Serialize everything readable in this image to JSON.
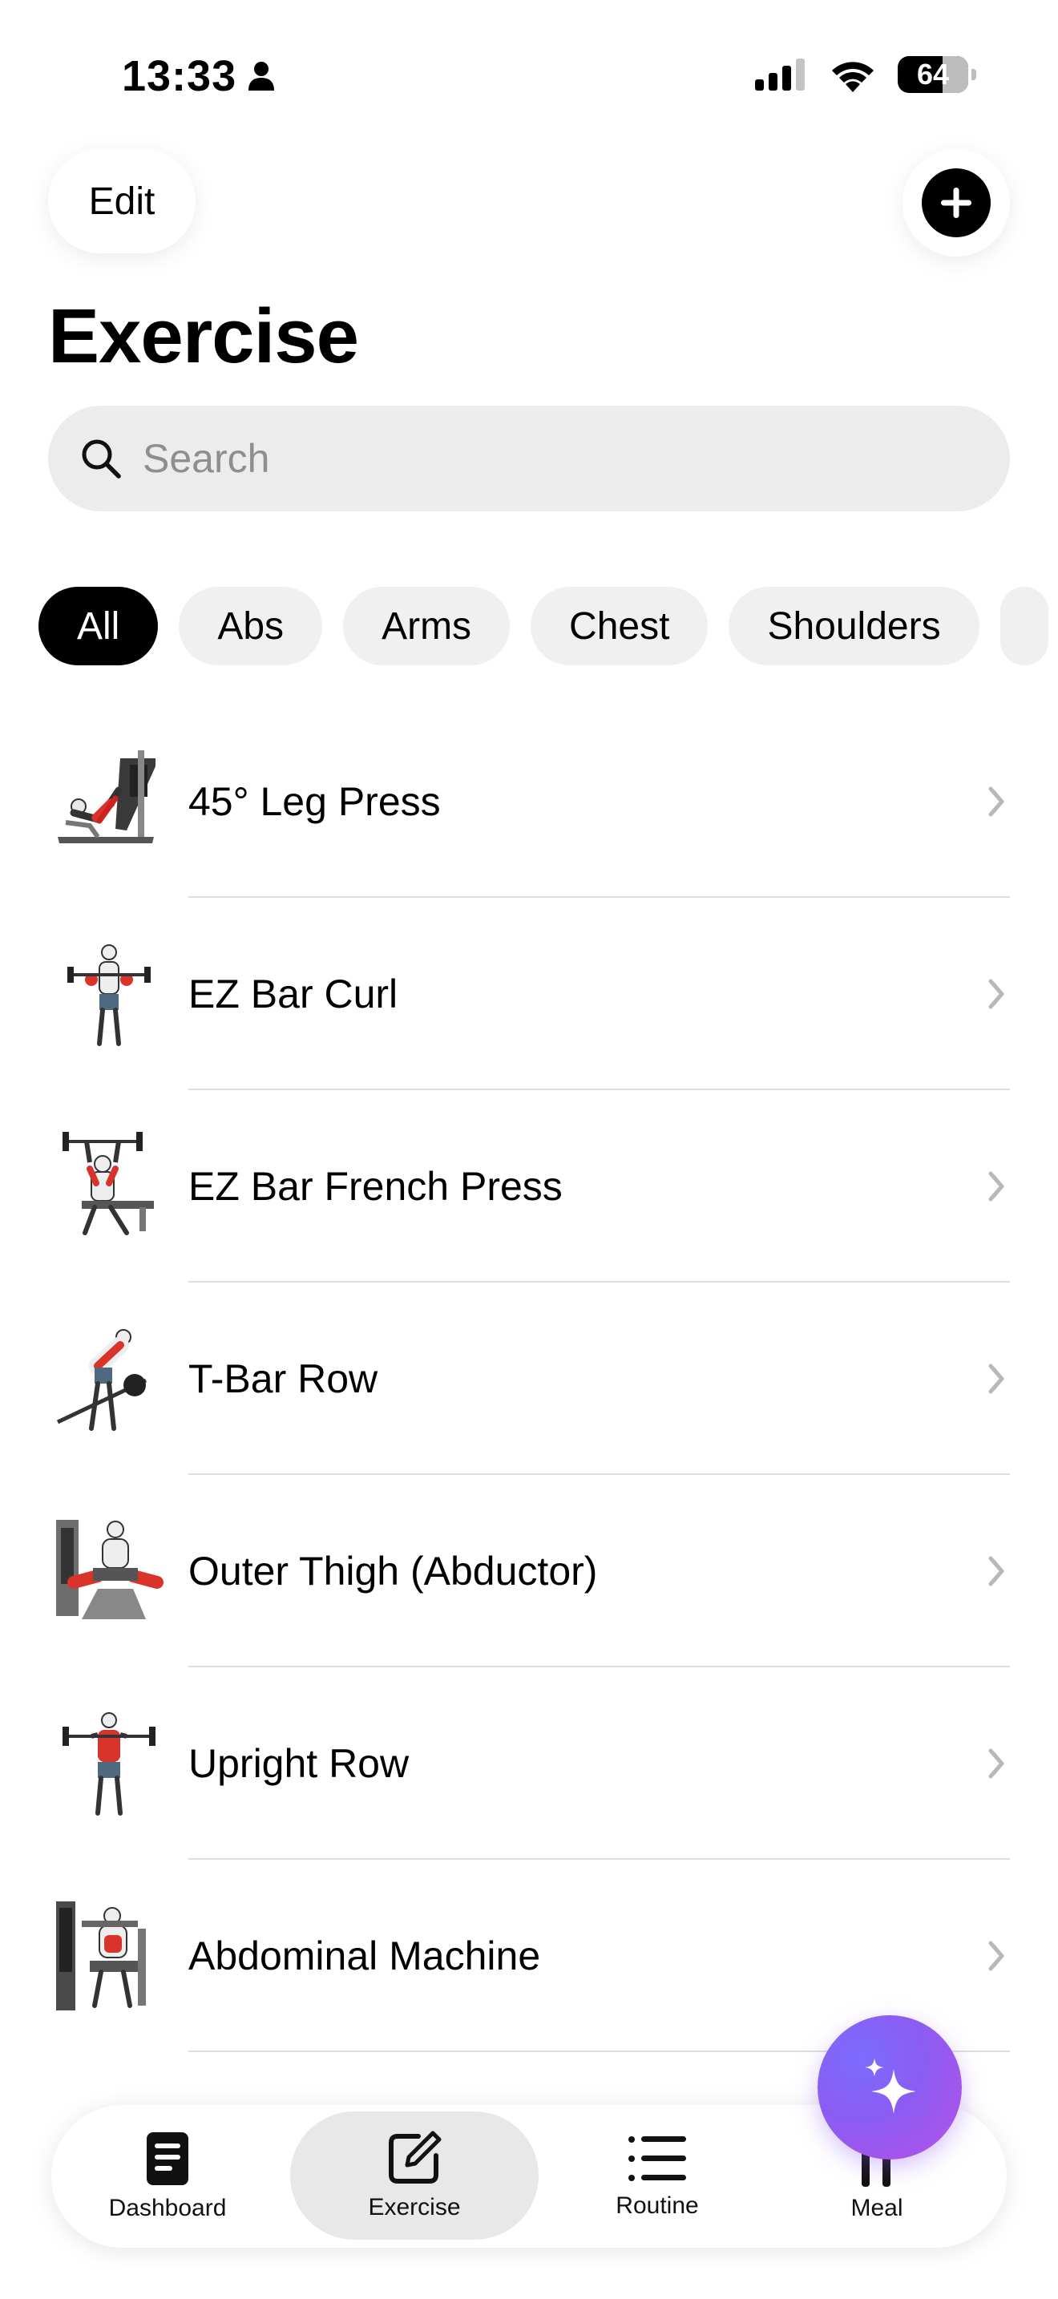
{
  "status": {
    "time": "13:33",
    "battery": "64",
    "battery_level": 0.64
  },
  "header": {
    "edit_label": "Edit",
    "title": "Exercise"
  },
  "search": {
    "placeholder": "Search",
    "value": ""
  },
  "filters": [
    {
      "label": "All",
      "selected": true
    },
    {
      "label": "Abs",
      "selected": false
    },
    {
      "label": "Arms",
      "selected": false
    },
    {
      "label": "Chest",
      "selected": false
    },
    {
      "label": "Shoulders",
      "selected": false
    }
  ],
  "exercises": [
    {
      "name": "45° Leg Press"
    },
    {
      "name": "EZ Bar Curl"
    },
    {
      "name": "EZ Bar French Press"
    },
    {
      "name": "T-Bar Row"
    },
    {
      "name": "Outer Thigh (Abductor)"
    },
    {
      "name": "Upright Row"
    },
    {
      "name": "Abdominal Machine"
    }
  ],
  "tabs": [
    {
      "label": "Dashboard",
      "icon": "document-icon",
      "selected": false
    },
    {
      "label": "Exercise",
      "icon": "edit-square-icon",
      "selected": true
    },
    {
      "label": "Routine",
      "icon": "list-icon",
      "selected": false
    },
    {
      "label": "Meal",
      "icon": "utensils-icon",
      "selected": false
    }
  ],
  "colors": {
    "accent": "#000000",
    "fab_start": "#7b6cff",
    "fab_end": "#b651e8",
    "muscle_highlight": "#d9342b"
  }
}
